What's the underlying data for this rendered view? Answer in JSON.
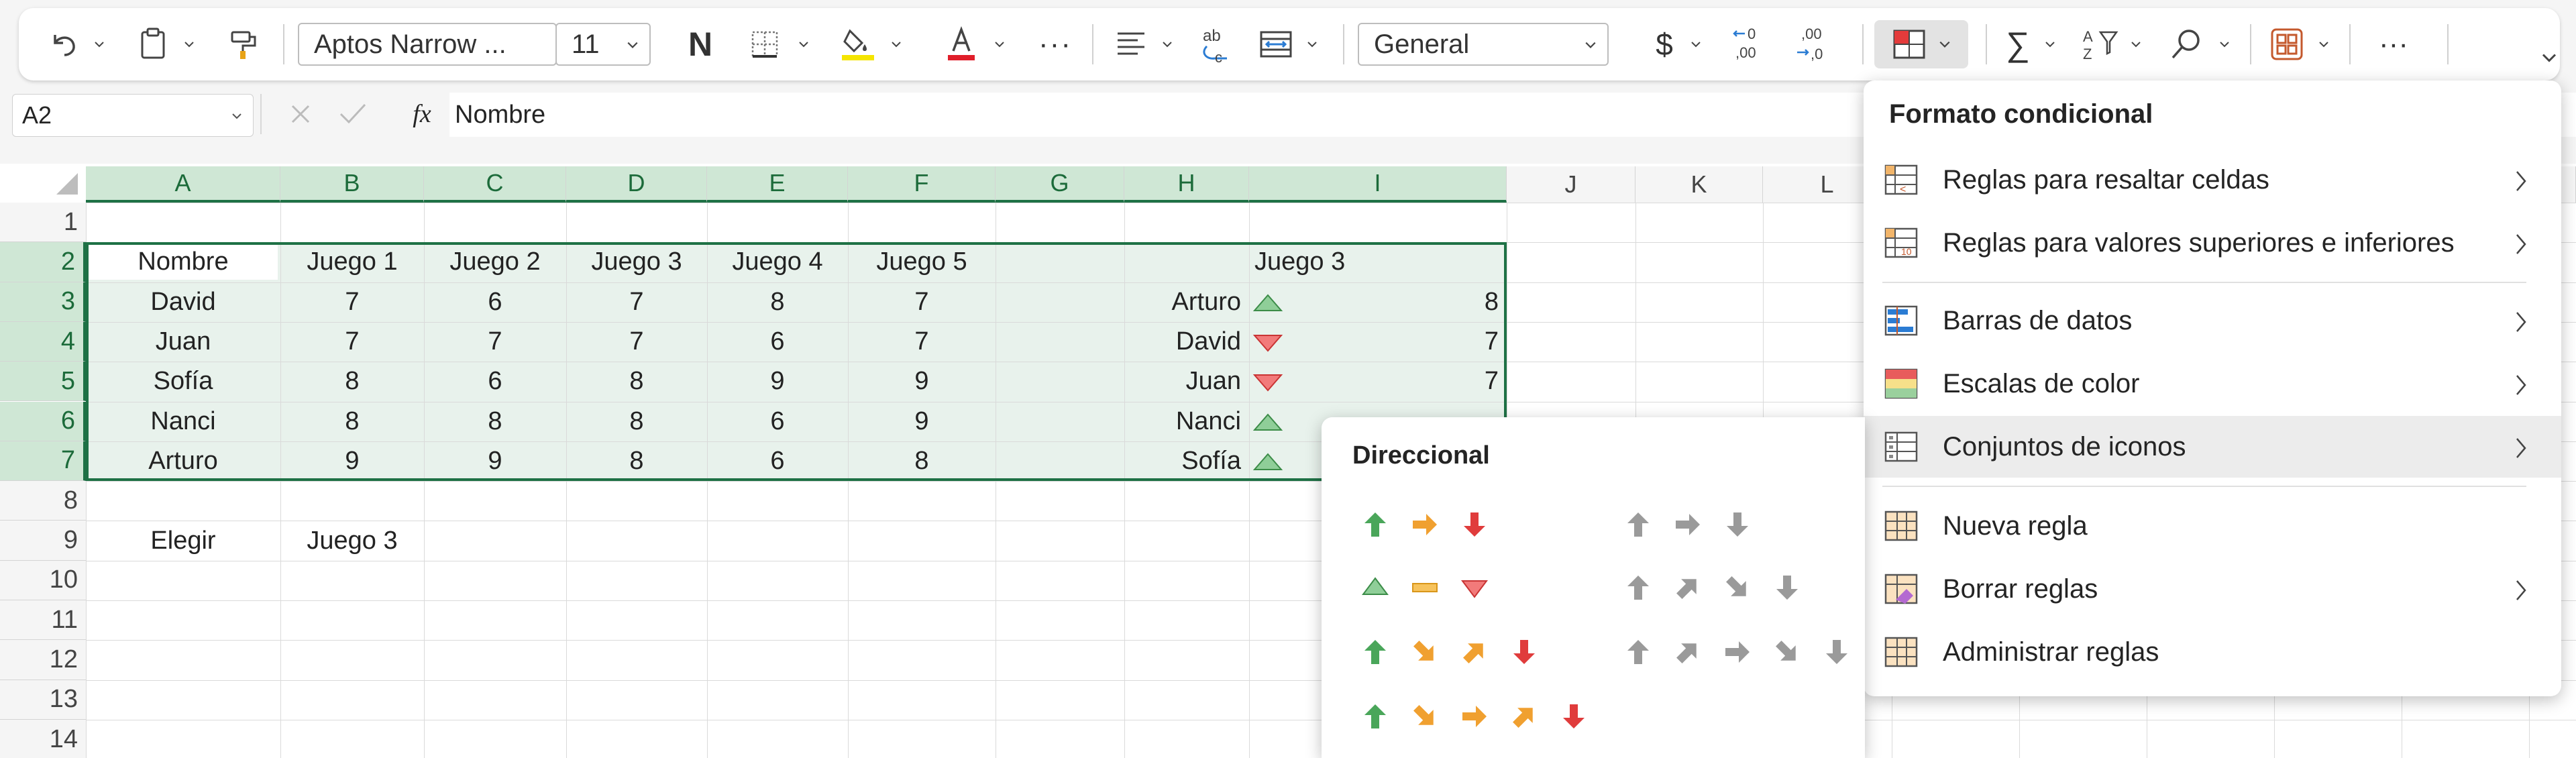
{
  "toolbar": {
    "font_name": "Aptos Narrow ...",
    "font_size": "11",
    "bold_label": "N",
    "number_format": "General"
  },
  "formula_bar": {
    "name_box": "A2",
    "fx_label": "fx",
    "content": "Nombre"
  },
  "sheet": {
    "columns": [
      "A",
      "B",
      "C",
      "D",
      "E",
      "F",
      "G",
      "H",
      "I",
      "J",
      "K",
      "L"
    ],
    "rows": [
      "1",
      "2",
      "3",
      "4",
      "5",
      "6",
      "7",
      "8",
      "9",
      "10",
      "11",
      "12",
      "13",
      "14"
    ],
    "header_row": [
      "Nombre",
      "Juego 1",
      "Juego 2",
      "Juego 3",
      "Juego 4",
      "Juego 5"
    ],
    "data": [
      [
        "David",
        "7",
        "6",
        "7",
        "8",
        "7"
      ],
      [
        "Juan",
        "7",
        "7",
        "7",
        "6",
        "7"
      ],
      [
        "Sofía",
        "8",
        "6",
        "8",
        "9",
        "9"
      ],
      [
        "Nanci",
        "8",
        "8",
        "8",
        "6",
        "9"
      ],
      [
        "Arturo",
        "9",
        "9",
        "8",
        "6",
        "8"
      ]
    ],
    "side_header": "Juego 3",
    "side_rows": [
      {
        "name": "Arturo",
        "icon": "triangle-up-icon",
        "value": "8"
      },
      {
        "name": "David",
        "icon": "triangle-down-icon",
        "value": "7"
      },
      {
        "name": "Juan",
        "icon": "triangle-down-icon",
        "value": "7"
      },
      {
        "name": "Nanci",
        "icon": "triangle-up-icon",
        "value": ""
      },
      {
        "name": "Sofía",
        "icon": "triangle-up-icon",
        "value": ""
      }
    ],
    "choose_label": "Elegir",
    "choose_value": "Juego 3"
  },
  "conditional_format_menu": {
    "title": "Formato condicional",
    "items": [
      {
        "label": "Reglas para resaltar celdas",
        "submenu": true
      },
      {
        "label": "Reglas para valores superiores e inferiores",
        "submenu": true
      },
      {
        "label": "Barras de datos",
        "submenu": true
      },
      {
        "label": "Escalas de color",
        "submenu": true
      },
      {
        "label": "Conjuntos de iconos",
        "submenu": true
      },
      {
        "label": "Nueva regla",
        "submenu": false
      },
      {
        "label": "Borrar reglas",
        "submenu": true
      },
      {
        "label": "Administrar reglas",
        "submenu": false
      }
    ]
  },
  "icon_sets_menu": {
    "section_title": "Direccional"
  },
  "colors": {
    "accent_green": "#1e7145",
    "selection_fill": "#e8f2ec",
    "header_selected": "#cfe7d5",
    "arrow_green": "#4aa65a",
    "arrow_orange": "#f0a030",
    "arrow_red": "#e03c3c",
    "arrow_gray": "#9a9a9a"
  }
}
